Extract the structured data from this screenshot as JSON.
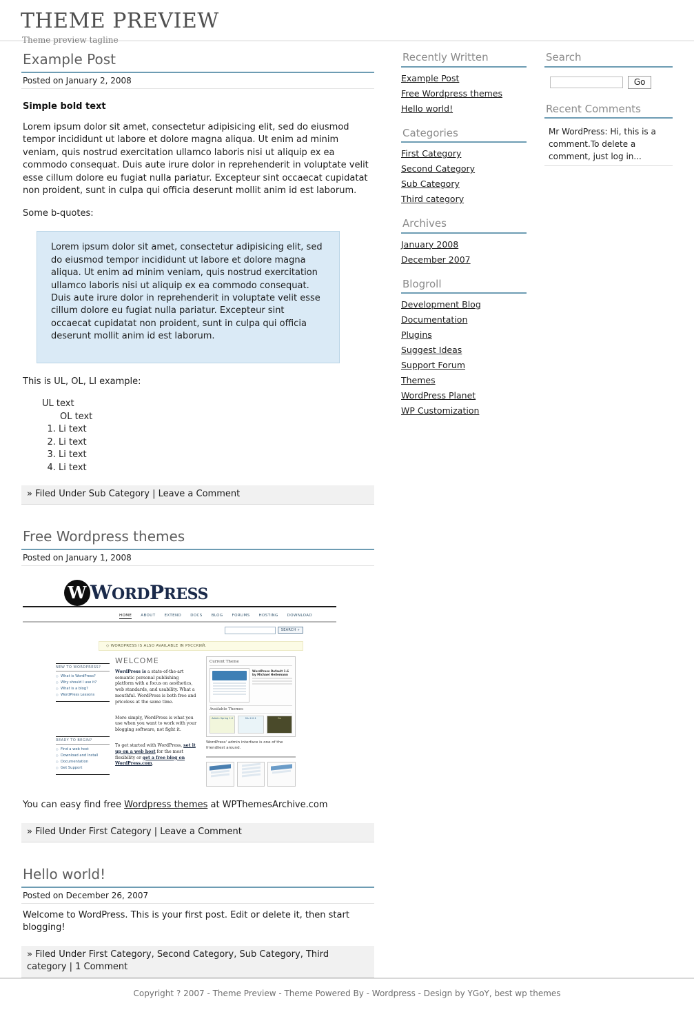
{
  "header": {
    "title": "THEME PREVIEW",
    "tagline": "Theme preview tagline"
  },
  "posts": [
    {
      "title": "Example Post",
      "date": "Posted on January 2, 2008",
      "bold_heading": "Simple bold text",
      "paragraph1": "Lorem ipsum dolor sit amet, consectetur adipisicing elit, sed do eiusmod tempor incididunt ut labore et dolore magna aliqua. Ut enim ad minim veniam, quis nostrud exercitation ullamco laboris nisi ut aliquip ex ea commodo consequat. Duis aute irure dolor in reprehenderit in voluptate velit esse cillum dolore eu fugiat nulla pariatur. Excepteur sint occaecat cupidatat non proident, sunt in culpa qui officia deserunt mollit anim id est laborum.",
      "paragraph2": "Some b-quotes:",
      "blockquote": "Lorem ipsum dolor sit amet, consectetur adipisicing elit, sed do eiusmod tempor incididunt ut labore et dolore magna aliqua. Ut enim ad minim veniam, quis nostrud exercitation ullamco laboris nisi ut aliquip ex ea commodo consequat. Duis aute irure dolor in reprehenderit in voluptate velit esse cillum dolore eu fugiat nulla pariatur. Excepteur sint occaecat cupidatat non proident, sunt in culpa qui officia deserunt mollit anim id est laborum.",
      "list_intro": "This is UL, OL, LI example:",
      "ul_text": "UL text",
      "ol_text": "OL text",
      "ol_items": [
        "Li text",
        "Li text",
        "Li text",
        "Li text"
      ],
      "meta": "» Filed Under Sub Category | Leave a Comment"
    },
    {
      "title": "Free Wordpress themes",
      "date": "Posted on January 1, 2008",
      "caption_before_link": "You can easy find free ",
      "caption_link": "Wordpress themes",
      "caption_after_link": " at WPThemesArchive.com",
      "meta": "» Filed Under First Category | Leave a Comment"
    },
    {
      "title": "Hello world!",
      "date": "Posted on December 26, 2007",
      "body": "Welcome to WordPress. This is your first post. Edit or delete it, then start blogging!",
      "meta": "» Filed Under First Category, Second Category, Sub Category, Third category | 1 Comment"
    }
  ],
  "wp_screenshot": {
    "wordmark_first": "W",
    "wordmark_ord": "ORD",
    "wordmark_p": "P",
    "wordmark_ress": "RESS",
    "logo_glyph": "W",
    "nav": [
      "HOME",
      "ABOUT",
      "EXTEND",
      "DOCS",
      "BLOG",
      "FORUMS",
      "HOSTING",
      "DOWNLOAD"
    ],
    "search_button": "SEARCH »",
    "notice": "◇ WORDPRESS IS ALSO AVAILABLE IN РУССКИЙ.",
    "new_to_title": "NEW TO WORDPRESS?",
    "new_to_links": [
      "What is WordPress?",
      "Why should I use it?",
      "What is a blog?",
      "WordPress Lessons"
    ],
    "ready_title": "READY TO BEGIN?",
    "ready_links": [
      "Find a web host",
      "Download and Install",
      "Documentation",
      "Get Support"
    ],
    "welcome": "WELCOME",
    "para1_bold": "WordPress is",
    "para1_rest": " a state-of-the-art semantic personal publishing platform with a focus on aesthetics, web standards, and usability. What a mouthful. WordPress is both free and priceless at the same time.",
    "para2": "More simply, WordPress is what you use when you want to work with your blogging software, not fight it.",
    "para3_a": "To get started with WordPress, ",
    "para3_link1": "set it up on a web host",
    "para3_b": " for the most flexibility or ",
    "para3_link2": "get a free blog on WordPress.com",
    "para3_c": ".",
    "current_theme_label": "Current Theme",
    "current_theme_name": "WordPress Default 1.6 by Michael Heilemann",
    "available_themes_label": "Available Themes",
    "available_theme_names": [
      "Admin Spring 1.0",
      "Mu 2.0.1",
      "Go"
    ],
    "admin_caption": "WordPress' admin interface is one of the friendliest around."
  },
  "sidebar_a": {
    "widgets": [
      {
        "title": "Recently Written",
        "items": [
          "Example Post",
          "Free Wordpress themes",
          "Hello world!"
        ]
      },
      {
        "title": "Categories",
        "items": [
          "First Category",
          "Second Category",
          "Sub Category",
          "Third category"
        ]
      },
      {
        "title": "Archives",
        "items": [
          "January 2008",
          "December 2007"
        ]
      },
      {
        "title": "Blogroll",
        "items": [
          "Development Blog",
          "Documentation",
          "Plugins",
          "Suggest Ideas",
          "Support Forum",
          "Themes",
          "WordPress Planet",
          "WP Customization"
        ]
      }
    ]
  },
  "sidebar_b": {
    "search": {
      "title": "Search",
      "value": "",
      "placeholder": "",
      "button": "Go"
    },
    "recent_comments": {
      "title": "Recent Comments",
      "items": [
        "Mr WordPress: Hi, this is a comment.To delete a comment, just log in..."
      ]
    }
  },
  "footer": {
    "text": "Copyright ? 2007 - Theme Preview - Theme Powered By - Wordpress - Design by YGoY, best wp themes"
  },
  "colors": {
    "accent_rule": "#6d9cb3",
    "blockquote_bg": "#daeaf6",
    "meta_bg": "#f1f1f1",
    "title_gray": "#5d5d5d"
  }
}
